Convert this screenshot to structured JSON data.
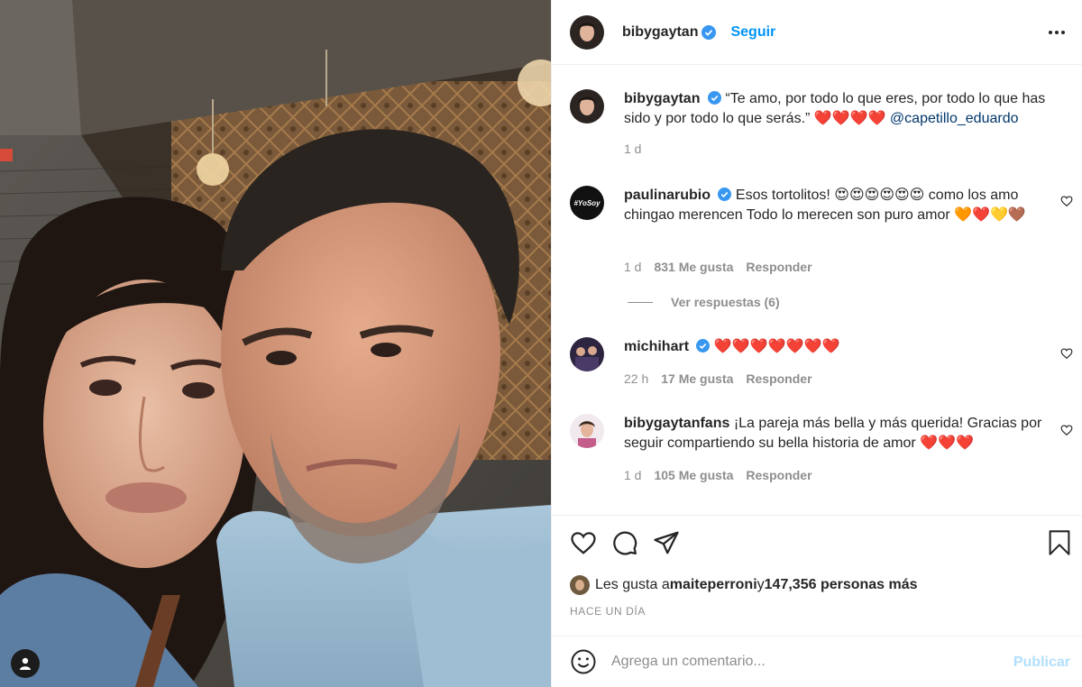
{
  "post": {
    "author": "bibygaytan",
    "follow_label": "Seguir",
    "verified_icon": "verified-badge-icon",
    "more_icon": "more-options-icon"
  },
  "caption": {
    "user": "bibygaytan",
    "text": "“Te amo, por todo lo que eres, por todo lo que has sido y por todo lo que serás.” ❤️❤️❤️❤️",
    "mention": "@capetillo_eduardo",
    "time": "1 d"
  },
  "comments": [
    {
      "user": "paulinarubio",
      "verified": true,
      "text": "Esos tortolitos! 😍😍😍😍😍😍 como los amo chingao merencen Todo lo merecen son puro amor 🧡❤️💛🤎",
      "time": "1 d",
      "likes": "831 Me gusta",
      "reply": "Responder",
      "view_replies": "Ver respuestas (6)"
    },
    {
      "user": "michihart",
      "verified": true,
      "text": "❤️❤️❤️❤️❤️❤️❤️",
      "time": "22 h",
      "likes": "17 Me gusta",
      "reply": "Responder"
    },
    {
      "user": "bibygaytanfans",
      "verified": false,
      "text": "¡La pareja más bella y más querida! Gracias por seguir compartiendo su bella historia de amor ❤️❤️❤️",
      "time": "1 d",
      "likes": "105 Me gusta",
      "reply": "Responder"
    }
  ],
  "likes": {
    "prefix": "Les gusta a ",
    "user": "maiteperroni",
    "middle": " y ",
    "count": "147,356 personas más"
  },
  "time_ago": "HACE UN DÍA",
  "add_comment": {
    "placeholder": "Agrega un comentario...",
    "publish_label": "Publicar"
  },
  "colors": {
    "link_blue": "#0095f6",
    "publish_disabled": "#b2dffc",
    "secondary_text": "#8e8e8e",
    "divider": "#efefef"
  }
}
